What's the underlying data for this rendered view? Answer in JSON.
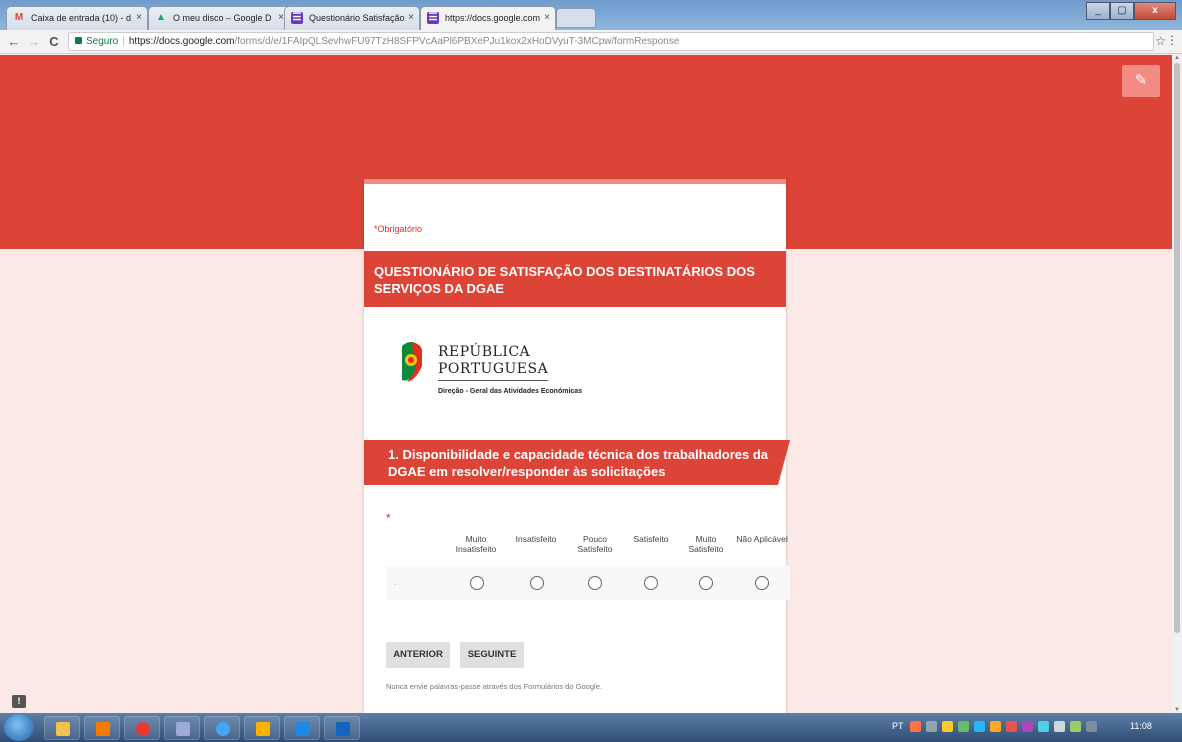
{
  "browser": {
    "tabs": [
      {
        "label": "Caixa de entrada (10) - d",
        "icon": "gmail-icon",
        "icon_glyph": "M",
        "icon_color": "#db4437"
      },
      {
        "label": "O meu disco – Google D",
        "icon": "drive-icon",
        "icon_glyph": "▲",
        "icon_color": "#1fa463"
      },
      {
        "label": "Questionário Satisfação",
        "icon": "forms-icon",
        "icon_glyph": "☰",
        "icon_color": "#673ab7"
      },
      {
        "label": "https://docs.google.com",
        "icon": "forms-icon",
        "icon_glyph": "☰",
        "icon_color": "#673ab7"
      }
    ],
    "close_glyph": "×",
    "nav": {
      "back": "←",
      "forward": "→",
      "reload": "C"
    },
    "address": {
      "secure_label": "Seguro",
      "host": "https://docs.google.com",
      "path": "/forms/d/e/1FAIpQLSevhwFU97TzH8SFPVcAaPl6PBXePJu1kox2xHoDVyuT-3MCpw/formResponse"
    },
    "star_glyph": "☆",
    "menu_glyph": "⋮"
  },
  "form": {
    "edit_glyph": "✎",
    "required_notice": "*Obrigatório",
    "title": "QUESTIONÁRIO DE SATISFAÇÃO DOS DESTINATÁRIOS DOS SERVIÇOS DA DGAE",
    "logo": {
      "line1": "REPÚBLICA",
      "line2": "PORTUGUESA",
      "org": "Direção - Geral das Atividades Económicas"
    },
    "section_title": "1. Disponibilidade e capacidade técnica dos trabalhadores da DGAE em resolver/responder às solicitações",
    "question_required_mark": "*",
    "scale": [
      "Muito Insatisfeito",
      "Insatisfeito",
      "Pouco Satisfeito",
      "Satisfeito",
      "Muito Satisfeito",
      "Não Aplicável"
    ],
    "row_label": ".",
    "buttons": {
      "back": "ANTERIOR",
      "next": "SEGUINTE"
    },
    "password_warning": "Nunca envie palavras-passe através dos Formulários do Google.",
    "feedback_glyph": "!"
  },
  "taskbar": {
    "language": "PT",
    "time": "11:08",
    "pinned": [
      {
        "name": "explorer-icon",
        "color": "#f2c14e"
      },
      {
        "name": "media-player-icon",
        "color": "#f57c00"
      },
      {
        "name": "chrome-icon",
        "color": "#e53935"
      },
      {
        "name": "paint-icon",
        "color": "#9fa8da"
      },
      {
        "name": "ie-icon",
        "color": "#42a5f5"
      },
      {
        "name": "outlook-icon",
        "color": "#ffb300"
      },
      {
        "name": "lync-icon",
        "color": "#1e88e5"
      },
      {
        "name": "word-icon",
        "color": "#1565c0"
      }
    ],
    "tray_icons": [
      {
        "name": "tray-icon-1",
        "color": "#ff7043"
      },
      {
        "name": "tray-icon-2",
        "color": "#90a4ae"
      },
      {
        "name": "tray-icon-3",
        "color": "#ffca28"
      },
      {
        "name": "tray-icon-4",
        "color": "#66bb6a"
      },
      {
        "name": "tray-icon-5",
        "color": "#29b6f6"
      },
      {
        "name": "tray-icon-6",
        "color": "#ffa726"
      },
      {
        "name": "tray-icon-7",
        "color": "#ef5350"
      },
      {
        "name": "tray-icon-8",
        "color": "#ab47bc"
      },
      {
        "name": "tray-icon-9",
        "color": "#4dd0e1"
      },
      {
        "name": "tray-icon-10",
        "color": "#cfd8dc"
      },
      {
        "name": "tray-icon-11",
        "color": "#9ccc65"
      },
      {
        "name": "tray-icon-12",
        "color": "#78909c"
      }
    ]
  },
  "colors": {
    "brand_red": "#db4437",
    "accent_pink": "#f28b82",
    "page_bg": "#fbe9e7"
  }
}
